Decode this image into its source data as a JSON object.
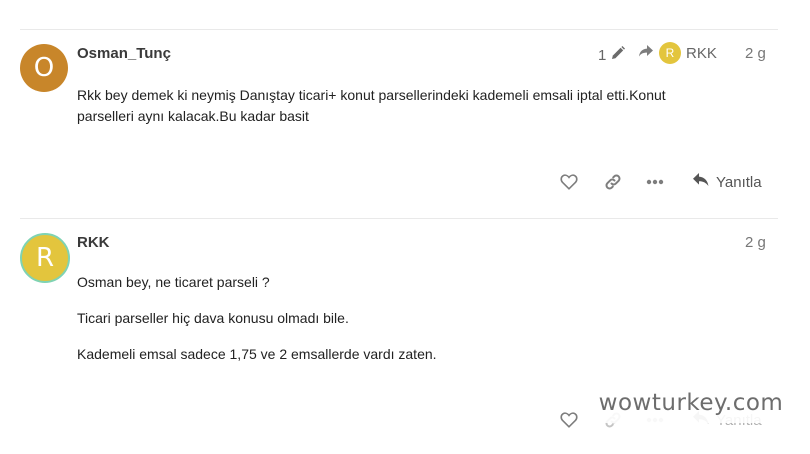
{
  "colors": {
    "avatar_osman": "#c8862a",
    "avatar_rkk": "#e3c53d",
    "avatar_rkk_ring": "#7fd3b3",
    "icon_gray": "#7d7d7d"
  },
  "posts": [
    {
      "username": "Osman_Tunç",
      "avatar_letter": "O",
      "age": "2 g",
      "edit_count": "1",
      "reply_to_user": "RKK",
      "reply_to_avatar_letter": "R",
      "paragraphs": [
        "Rkk bey demek ki neymiş Danıştay ticari+ konut parsellerindeki kademeli emsali iptal etti.Konut parselleri aynı kalacak.Bu kadar basit"
      ],
      "reply_label": "Yanıtla"
    },
    {
      "username": "RKK",
      "avatar_letter": "R",
      "age": "2 g",
      "paragraphs": [
        "Osman bey, ne ticaret parseli ?",
        "Ticari parseller hiç dava konusu olmadı bile.",
        "Kademeli emsal sadece 1,75 ve 2 emsallerde vardı zaten."
      ],
      "reply_label": "Yanıtla"
    }
  ],
  "watermark": "wowturkey.com",
  "icons": [
    "heart-icon",
    "link-icon",
    "more-icon",
    "reply-icon",
    "pencil-icon",
    "share-arrow-icon"
  ]
}
